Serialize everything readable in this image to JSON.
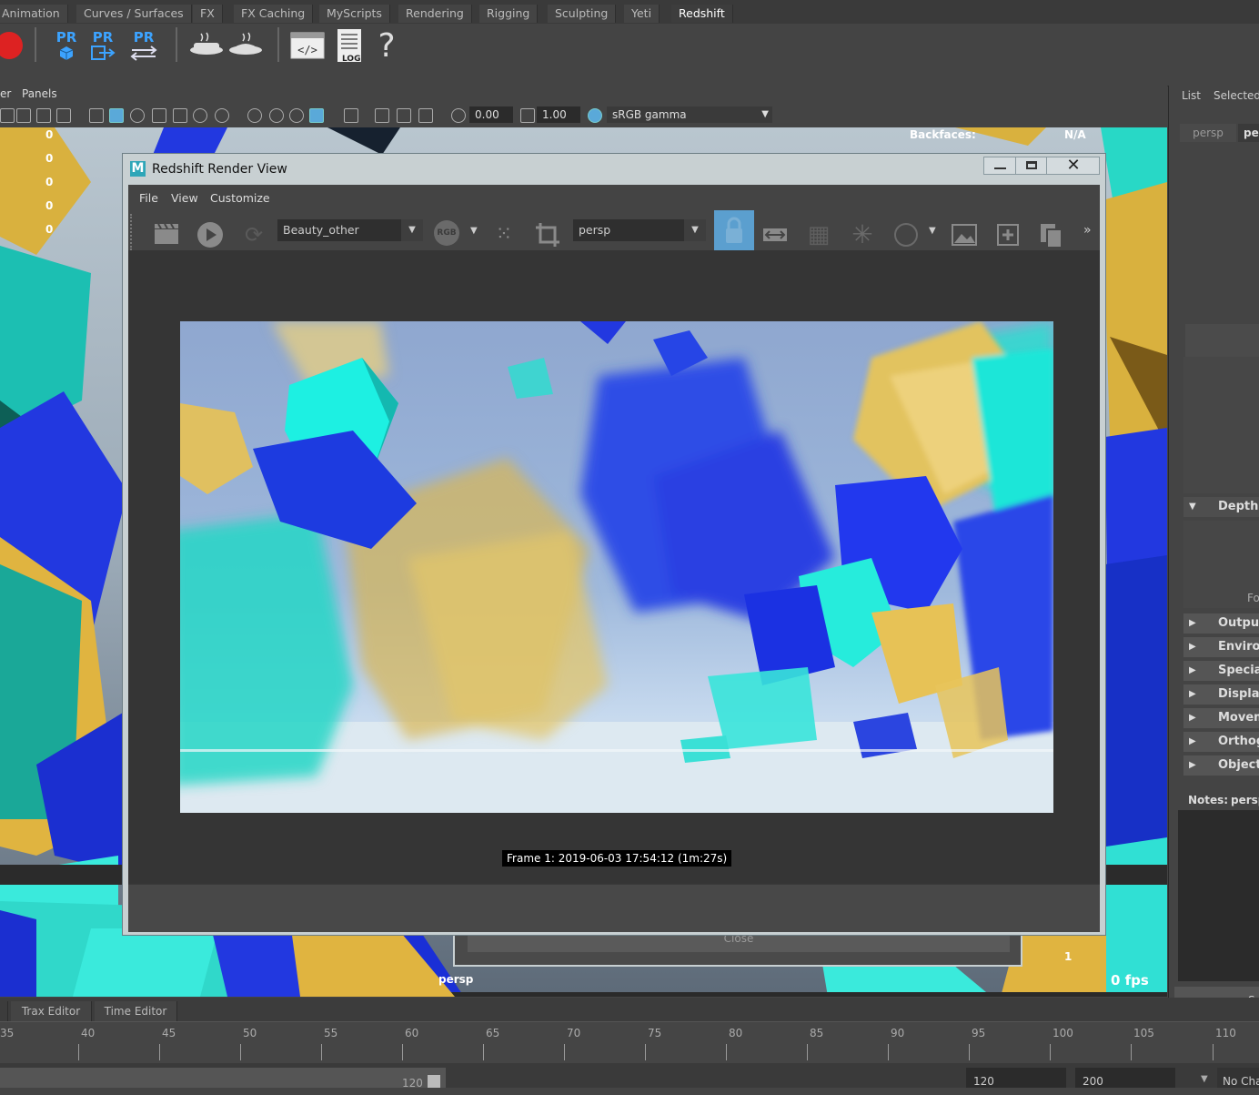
{
  "shelf_tabs": [
    "Animation",
    "Curves / Surfaces",
    "FX",
    "FX Caching",
    "MyScripts",
    "Rendering",
    "Rigging",
    "Sculpting",
    "Yeti",
    "Redshift"
  ],
  "shelf_active": "Redshift",
  "shelf_buttons": {
    "pr1": "PR",
    "pr2": "PR",
    "pr3": "PR",
    "log": "LOG",
    "help": "?"
  },
  "panel_menu": {
    "left_partial": "er",
    "panels": "Panels"
  },
  "viewport_toolbar": {
    "exposure": "0.00",
    "gamma": "1.00",
    "colorspace": "sRGB gamma"
  },
  "viewport_hud": {
    "left_values": [
      "0",
      "0",
      "0",
      "0",
      "0"
    ],
    "backfaces_label": "Backfaces:",
    "backfaces_value": "N/A",
    "camera": "persp",
    "frame_count": "1",
    "fps": "0 fps"
  },
  "close_button": {
    "label": "Close"
  },
  "right_panel": {
    "tabs": [
      "List",
      "Selected"
    ],
    "camera_tabs": [
      "persp",
      "pe"
    ],
    "sections": [
      "Depth o",
      "Output",
      "Environ",
      "Special",
      "Display",
      "Movem",
      "Orthog",
      "Object"
    ],
    "partial_label": "Fo",
    "notes_label": "Notes:",
    "notes_value": "persp",
    "select_partial": "Se"
  },
  "bottom_tabs": [
    "Trax Editor",
    "Time Editor"
  ],
  "timeline": {
    "ticks": [
      "35",
      "40",
      "45",
      "50",
      "55",
      "60",
      "65",
      "70",
      "75",
      "80",
      "85",
      "90",
      "95",
      "100",
      "105",
      "110"
    ]
  },
  "range": {
    "end_inner": "120",
    "end": "120",
    "max": "200",
    "no_char": "No Cha"
  },
  "render_view": {
    "title": "Redshift Render View",
    "app_icon": "M",
    "menu": [
      "File",
      "View",
      "Customize"
    ],
    "aov": "Beauty_other",
    "rgb": "RGB",
    "camera": "persp",
    "frame_label": "Frame  1:  2019-06-03  17:54:12  (1m:27s)",
    "more": "»"
  },
  "colors": {
    "accent": "#3ca3ff",
    "lock": "#5b9fcf",
    "teal": "#1ee8dc",
    "yellow": "#e6c04a",
    "blue": "#2238e0"
  }
}
